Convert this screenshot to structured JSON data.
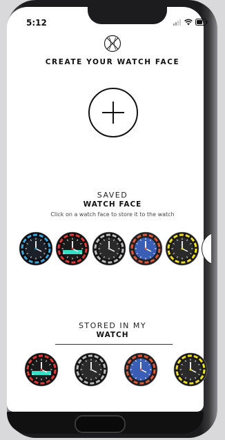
{
  "status": {
    "time": "5:12"
  },
  "header": {
    "title": "CREATE YOUR WATCH FACE"
  },
  "saved": {
    "title_line1": "SAVED",
    "title_line2": "WATCH FACE",
    "hint": "Click on a watch face to store it to the watch",
    "faces": [
      {
        "bezel": "#0d0d0f",
        "accent": "#3aa6e0",
        "dial": "#1b1f27"
      },
      {
        "bezel": "#111111",
        "accent": "#e03a3a",
        "dial": "#1a1a1a",
        "band": "#36e0c8"
      },
      {
        "bezel": "#151515",
        "accent": "#bdbdbd",
        "dial": "#2a2a2a"
      },
      {
        "bezel": "#1f1f22",
        "accent": "#e05a3a",
        "dial": "#3a5db5"
      },
      {
        "bezel": "#1a1a1a",
        "accent": "#f0e020",
        "dial": "#2a2a2a"
      }
    ]
  },
  "stored": {
    "title_line1": "STORED IN MY",
    "title_line2": "WATCH",
    "faces": [
      {
        "bezel": "#111111",
        "accent": "#e03a3a",
        "dial": "#1a1a1a",
        "band": "#36e0c8"
      },
      {
        "bezel": "#151515",
        "accent": "#bdbdbd",
        "dial": "#2a2a2a"
      },
      {
        "bezel": "#1f1f22",
        "accent": "#e05a3a",
        "dial": "#3a5db5"
      },
      {
        "bezel": "#1a1a1a",
        "accent": "#f0e020",
        "dial": "#2a2a2a"
      }
    ]
  }
}
